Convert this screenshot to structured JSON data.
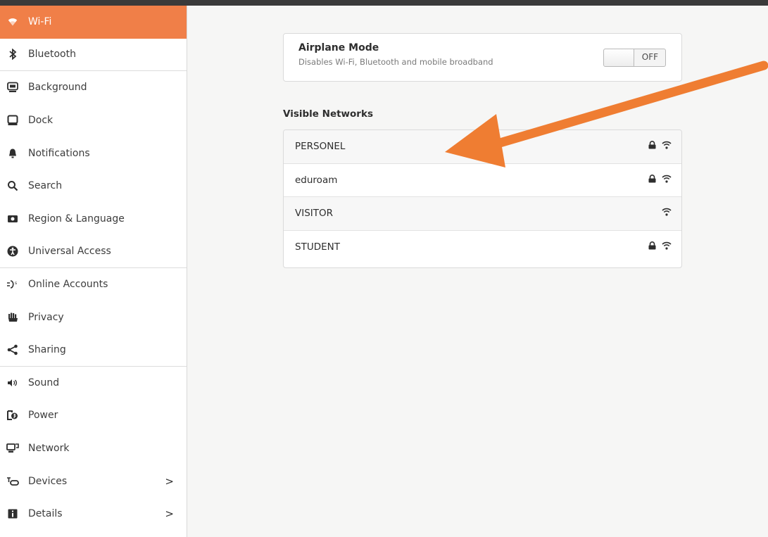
{
  "sidebar": {
    "items": [
      {
        "label": "Wi-Fi",
        "icon": "wifi-icon",
        "active": true
      },
      {
        "label": "Bluetooth",
        "icon": "bluetooth-icon"
      },
      {
        "label": "Background",
        "icon": "background-icon"
      },
      {
        "label": "Dock",
        "icon": "dock-icon"
      },
      {
        "label": "Notifications",
        "icon": "bell-icon"
      },
      {
        "label": "Search",
        "icon": "search-icon"
      },
      {
        "label": "Region & Language",
        "icon": "region-icon"
      },
      {
        "label": "Universal Access",
        "icon": "universal-access-icon"
      },
      {
        "label": "Online Accounts",
        "icon": "online-accounts-icon"
      },
      {
        "label": "Privacy",
        "icon": "privacy-hand-icon"
      },
      {
        "label": "Sharing",
        "icon": "share-icon"
      },
      {
        "label": "Sound",
        "icon": "speaker-icon"
      },
      {
        "label": "Power",
        "icon": "power-icon"
      },
      {
        "label": "Network",
        "icon": "network-icon"
      },
      {
        "label": "Devices",
        "icon": "devices-icon",
        "chevron": ">"
      },
      {
        "label": "Details",
        "icon": "details-icon",
        "chevron": ">"
      }
    ]
  },
  "airplane": {
    "title": "Airplane Mode",
    "subtitle": "Disables Wi-Fi, Bluetooth and mobile broadband",
    "toggle_label": "OFF"
  },
  "networks": {
    "title": "Visible Networks",
    "items": [
      {
        "name": "PERSONEL",
        "locked": true
      },
      {
        "name": "eduroam",
        "locked": true
      },
      {
        "name": "VISITOR",
        "locked": false
      },
      {
        "name": "STUDENT",
        "locked": true
      }
    ]
  },
  "colors": {
    "accent": "#f07f48",
    "annotation_arrow": "#ef7d32"
  }
}
